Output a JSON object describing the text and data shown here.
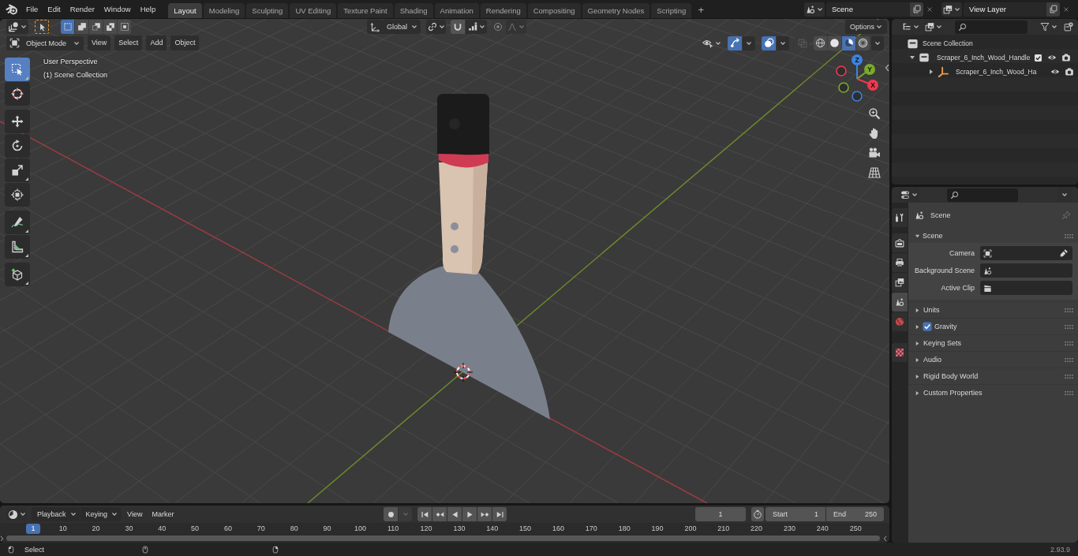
{
  "topbar": {
    "menus": [
      "File",
      "Edit",
      "Render",
      "Window",
      "Help"
    ],
    "workspaces": [
      {
        "label": "Layout",
        "selected": true
      },
      {
        "label": "Modeling",
        "selected": false
      },
      {
        "label": "Sculpting",
        "selected": false
      },
      {
        "label": "UV Editing",
        "selected": false
      },
      {
        "label": "Texture Paint",
        "selected": false
      },
      {
        "label": "Shading",
        "selected": false
      },
      {
        "label": "Animation",
        "selected": false
      },
      {
        "label": "Rendering",
        "selected": false
      },
      {
        "label": "Compositing",
        "selected": false
      },
      {
        "label": "Geometry Nodes",
        "selected": false
      },
      {
        "label": "Scripting",
        "selected": false
      }
    ],
    "add_workspace": "+",
    "scene": "Scene",
    "view_layer": "View Layer"
  },
  "tool_header": {
    "select_modes": [
      {
        "selected": true
      },
      {
        "selected": false
      },
      {
        "selected": false
      },
      {
        "selected": false
      },
      {
        "selected": false
      }
    ],
    "orientation": "Global",
    "snap_on": false,
    "proportional_on": false,
    "options": "Options"
  },
  "viewport_header": {
    "mode": "Object Mode",
    "menus": [
      "View",
      "Select",
      "Add",
      "Object"
    ],
    "gizmos_on": true,
    "overlays_on": true,
    "xray_on": false,
    "shading_modes": [
      {
        "selected": false
      },
      {
        "selected": false
      },
      {
        "selected": true
      },
      {
        "selected": false
      }
    ]
  },
  "toolbar": {
    "tools": [
      {
        "selected": true
      },
      {
        "selected": false
      },
      {
        "selected": false
      },
      {
        "selected": false
      },
      {
        "selected": false
      },
      {
        "selected": false
      },
      {
        "selected": false
      },
      {
        "selected": false
      },
      {
        "selected": false
      }
    ]
  },
  "viewport_overlay": {
    "view_name": "User Perspective",
    "collection": "(1) Scene Collection"
  },
  "navigation_gizmo": {
    "axes": [
      {
        "label": "Z",
        "color": "#3b83e0"
      },
      {
        "label": "Y",
        "color": "#7bab2c"
      },
      {
        "label": "X",
        "color": "#ed3a50"
      }
    ]
  },
  "outliner": {
    "root": "Scene Collection",
    "items": [
      {
        "kind": "collection",
        "label": "Scraper_6_Inch_Wood_Handle",
        "expanded": true,
        "checked": true,
        "children": [
          {
            "kind": "object",
            "label": "Scraper_6_Inch_Wood_Ha",
            "expanded": false
          }
        ]
      }
    ]
  },
  "properties": {
    "tabs": [
      {
        "selected": false
      },
      {
        "selected": false
      },
      {
        "selected": false
      },
      {
        "selected": false
      },
      {
        "selected": true
      },
      {
        "selected": false
      },
      {
        "selected": false
      }
    ],
    "context": "Scene",
    "panel": {
      "title": "Scene",
      "expanded": true,
      "fields": [
        {
          "kind": "object",
          "label": "Camera"
        },
        {
          "kind": "scene",
          "label": "Background Scene"
        },
        {
          "kind": "clip",
          "label": "Active Clip"
        }
      ]
    },
    "subpanels": [
      {
        "kind": "plain",
        "label": "Units",
        "expanded": false
      },
      {
        "kind": "toggle",
        "label": "Gravity",
        "checked": true,
        "expanded": false
      },
      {
        "kind": "plain",
        "label": "Keying Sets",
        "expanded": false
      },
      {
        "kind": "plain",
        "label": "Audio",
        "expanded": false
      },
      {
        "kind": "plain",
        "label": "Rigid Body World",
        "expanded": false
      },
      {
        "kind": "plain",
        "label": "Custom Properties",
        "expanded": false
      }
    ]
  },
  "timeline": {
    "menus": [
      {
        "kind": "dropdown",
        "label": "Playback"
      },
      {
        "kind": "dropdown",
        "label": "Keying"
      },
      {
        "kind": "menu",
        "label": "View"
      },
      {
        "kind": "menu",
        "label": "Marker"
      }
    ],
    "auto_keying": false,
    "current_frame": "1",
    "start_label": "Start",
    "start": "1",
    "end_label": "End",
    "end": "250",
    "playhead": "1",
    "frame_labels": [
      "10",
      "20",
      "30",
      "40",
      "50",
      "60",
      "70",
      "80",
      "90",
      "100",
      "110",
      "120",
      "130",
      "140",
      "150",
      "160",
      "170",
      "180",
      "190",
      "200",
      "210",
      "220",
      "230",
      "240",
      "250"
    ]
  },
  "status_bar": {
    "hint": "Select",
    "version": "2.93.9"
  }
}
